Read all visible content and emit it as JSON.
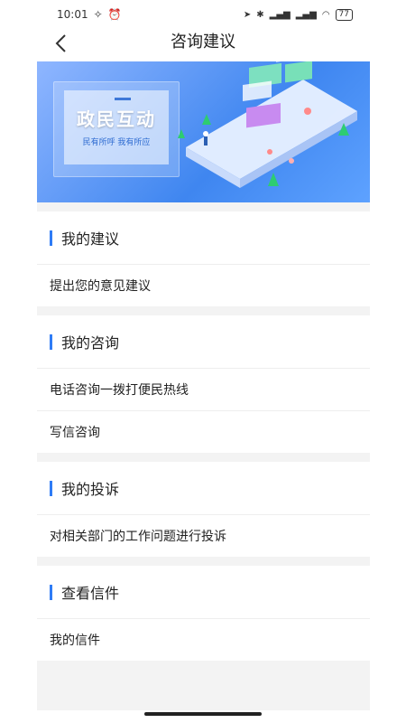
{
  "status_bar": {
    "time": "10:01",
    "battery": "77"
  },
  "nav": {
    "title": "咨询建议"
  },
  "banner": {
    "title": "政民互动",
    "subtitle": "民有所呼  我有所应"
  },
  "sections": [
    {
      "header": "我的建议",
      "items": [
        "提出您的意见建议"
      ]
    },
    {
      "header": "我的咨询",
      "items": [
        "电话咨询一拨打便民热线",
        "写信咨询"
      ]
    },
    {
      "header": "我的投诉",
      "items": [
        "对相关部门的工作问题进行投诉"
      ]
    },
    {
      "header": "查看信件",
      "items": [
        "我的信件"
      ]
    }
  ],
  "colors": {
    "accent": "#2f7cf6",
    "banner": "#3f86f0"
  }
}
